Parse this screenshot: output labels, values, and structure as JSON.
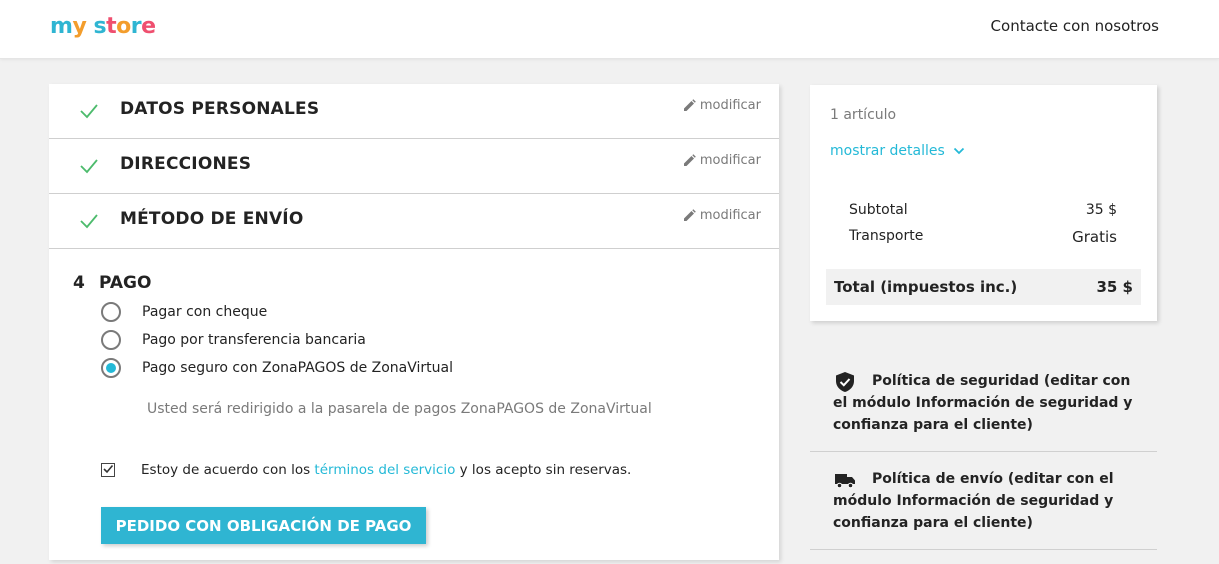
{
  "header": {
    "logo": [
      "m",
      "y",
      " ",
      "s",
      "t",
      "o",
      "r",
      "e"
    ],
    "logo_colors": [
      "#2fb5d2",
      "#f39d2c",
      "#fff",
      "#2fb5d2",
      "#ef4f6f",
      "#f39d2c",
      "#2fb5d2",
      "#ef4f6f"
    ],
    "contact_link": "Contacte con nosotros"
  },
  "steps": [
    {
      "title": "DATOS PERSONALES",
      "edit": "modificar",
      "status": "check-icon"
    },
    {
      "title": "DIRECCIONES",
      "edit": "modificar",
      "status": "check-icon"
    },
    {
      "title": "MÉTODO DE ENVÍO",
      "edit": "modificar",
      "status": "check-icon"
    }
  ],
  "payment": {
    "number": "4",
    "title": "PAGO",
    "options": [
      {
        "label": "Pagar con cheque",
        "selected": false
      },
      {
        "label": "Pago por transferencia bancaria",
        "selected": false
      },
      {
        "label": "Pago seguro con ZonaPAGOS de ZonaVirtual",
        "selected": true
      }
    ],
    "redirect_note": "Usted será redirigido a la pasarela de pagos ZonaPAGOS de ZonaVirtual",
    "agree_prefix": "Estoy de acuerdo con los ",
    "agree_link": "términos del servicio",
    "agree_suffix": " y los acepto sin reservas.",
    "agree_checked": true,
    "order_button": "PEDIDO CON OBLIGACIÓN DE PAGO"
  },
  "summary": {
    "items_count": "1 artículo",
    "show_details": "mostrar detalles",
    "subtotal_label": "Subtotal",
    "subtotal_value": "35 $",
    "shipping_label": "Transporte",
    "shipping_value": "Gratis",
    "total_label": "Total (impuestos inc.)",
    "total_value": "35 $"
  },
  "reassurance": [
    {
      "icon": "shield-check-icon",
      "text": "Política de seguridad (editar con el módulo Información de seguridad y confianza para el cliente)"
    },
    {
      "icon": "truck-icon",
      "text": "Política de envío (editar con el módulo Información de seguridad y confianza para el cliente)"
    }
  ],
  "colors": {
    "accent": "#2fb5d2",
    "check": "#4cbb6c",
    "background": "#f1f1f1"
  }
}
